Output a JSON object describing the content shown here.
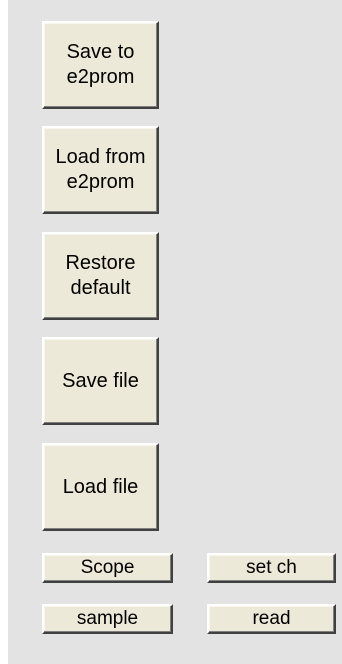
{
  "buttons": {
    "save_to_e2prom": "Save to\ne2prom",
    "load_from_e2prom": "Load from\ne2prom",
    "restore_default": "Restore\ndefault",
    "save_file": "Save file",
    "load_file": "Load file",
    "scope": "Scope",
    "set_ch": "set ch",
    "sample": "sample",
    "read": "read"
  },
  "colors": {
    "panel_background": "#e3e3e3",
    "button_face": "#ece9d8"
  }
}
